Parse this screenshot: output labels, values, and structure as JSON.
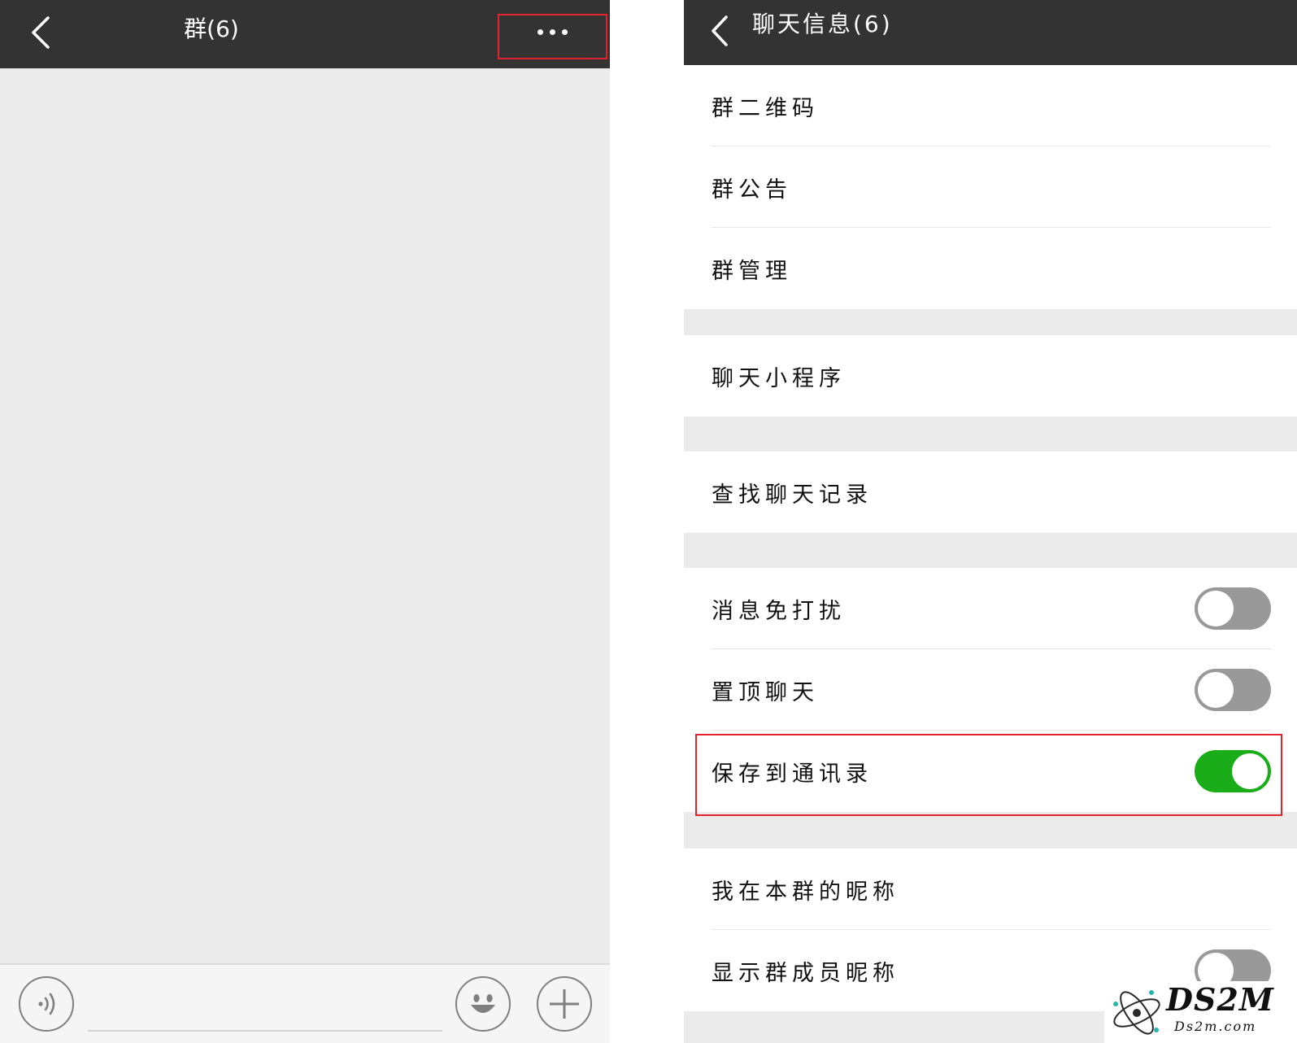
{
  "left": {
    "title": "群(6)",
    "icons": {
      "back": "chevron-left-icon",
      "more": "more-dots-icon",
      "voice": "voice-icon",
      "emoji": "emoji-icon",
      "plus": "plus-icon"
    }
  },
  "right": {
    "title": "聊天信息(6)",
    "group_a": [
      "群二维码",
      "群公告",
      "群管理"
    ],
    "group_b": [
      "聊天小程序"
    ],
    "group_c": [
      "查找聊天记录"
    ],
    "group_d": {
      "mute": "消息免打扰",
      "sticky": "置顶聊天",
      "save": "保存到通讯录"
    },
    "toggles": {
      "mute": false,
      "sticky": false,
      "save": true,
      "show_nicknames": false
    },
    "group_e": {
      "my_nickname": "我在本群的昵称",
      "show_nicknames": "显示群成员昵称"
    }
  },
  "watermark": {
    "brand": "DS2M",
    "domain": "Ds2m.com"
  },
  "colors": {
    "header": "#333333",
    "toggle_on": "#1aad19",
    "toggle_off": "#999999",
    "highlight": "#e0232c",
    "background": "#ebebeb"
  }
}
